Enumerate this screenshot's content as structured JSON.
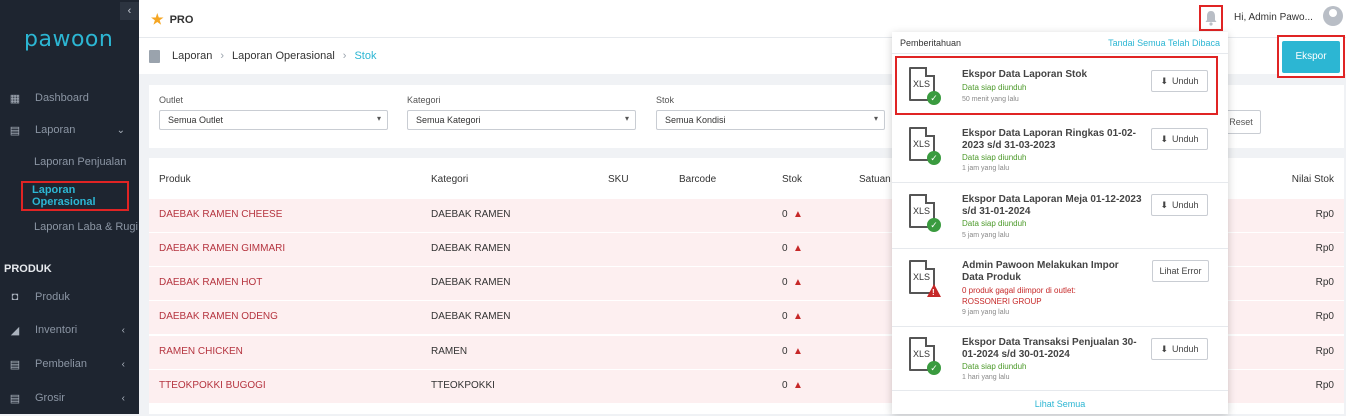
{
  "sidebar": {
    "logo": "pawoon",
    "items": [
      {
        "label": "Dashboard"
      },
      {
        "label": "Laporan"
      },
      {
        "label": "Laporan Penjualan"
      },
      {
        "label": "Laporan Operasional"
      },
      {
        "label": "Laporan Laba & Rugi"
      },
      {
        "label": "Produk"
      },
      {
        "label": "Inventori"
      },
      {
        "label": "Pembelian"
      },
      {
        "label": "Grosir"
      }
    ],
    "section_title": "PRODUK"
  },
  "header": {
    "plan": "PRO",
    "greeting": "Hi, Admin Pawo..."
  },
  "breadcrumb": [
    "Laporan",
    "Laporan Operasional",
    "Stok"
  ],
  "export_label": "Ekspor",
  "filters": {
    "outlet_label": "Outlet",
    "outlet_value": "Semua Outlet",
    "kategori_label": "Kategori",
    "kategori_value": "Semua Kategori",
    "stok_label": "Stok",
    "stok_value": "Semua Kondisi",
    "reset_label": "Reset"
  },
  "table": {
    "headers": [
      "Produk",
      "Kategori",
      "SKU",
      "Barcode",
      "Stok",
      "Satuan",
      "Nilai Stok"
    ],
    "rows": [
      {
        "produk": "DAEBAK RAMEN CHEESE",
        "kategori": "DAEBAK RAMEN",
        "stok": "0",
        "nilai": "Rp0"
      },
      {
        "produk": "DAEBAK RAMEN GIMMARI",
        "kategori": "DAEBAK RAMEN",
        "stok": "0",
        "nilai": "Rp0"
      },
      {
        "produk": "DAEBAK RAMEN HOT",
        "kategori": "DAEBAK RAMEN",
        "stok": "0",
        "nilai": "Rp0"
      },
      {
        "produk": "DAEBAK RAMEN ODENG",
        "kategori": "DAEBAK RAMEN",
        "stok": "0",
        "nilai": "Rp0"
      },
      {
        "produk": "RAMEN CHICKEN",
        "kategori": "RAMEN",
        "stok": "0",
        "nilai": "Rp0"
      },
      {
        "produk": "TTEOKPOKKI BUGOGI",
        "kategori": "TTEOKPOKKI",
        "stok": "0",
        "nilai": "Rp0"
      }
    ]
  },
  "notifications": {
    "title": "Pemberitahuan",
    "mark_all": "Tandai Semua Telah Dibaca",
    "see_all": "Lihat Semua",
    "file_type": "XLS",
    "items": [
      {
        "title": "Ekspor Data Laporan Stok",
        "status": "Data siap diunduh",
        "time": "50 menit yang lalu",
        "button": "Unduh"
      },
      {
        "title": "Ekspor Data Laporan Ringkas 01-02-2023 s/d 31-03-2023",
        "status": "Data siap diunduh",
        "time": "1 jam yang lalu",
        "button": "Unduh"
      },
      {
        "title": "Ekspor Data Laporan Meja 01-12-2023 s/d 31-01-2024",
        "status": "Data siap diunduh",
        "time": "5 jam yang lalu",
        "button": "Unduh"
      },
      {
        "title": "Admin Pawoon Melakukan Impor Data Produk",
        "status": "0 produk gagal diimpor di outlet: ROSSONERI GROUP",
        "time": "9 jam yang lalu",
        "button": "Lihat Error"
      },
      {
        "title": "Ekspor Data Transaksi Penjualan 30-01-2024 s/d 30-01-2024",
        "status": "Data siap diunduh",
        "time": "1 hari yang lalu",
        "button": "Unduh"
      }
    ]
  }
}
